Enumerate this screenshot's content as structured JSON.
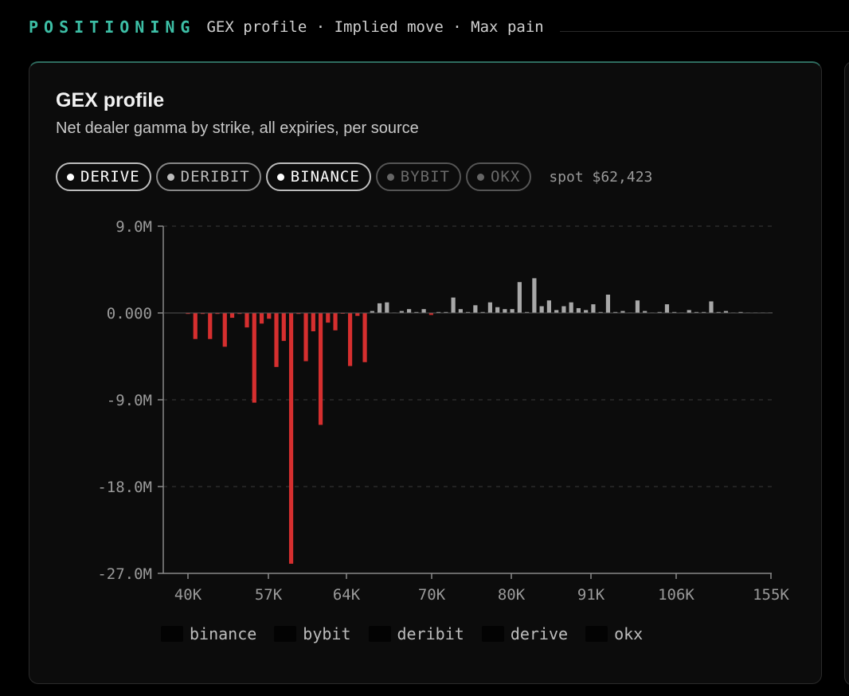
{
  "header": {
    "tag": "POSITIONING",
    "subtitle": "GEX profile · Implied move · Max pain"
  },
  "card": {
    "title": "GEX profile",
    "subtitle": "Net dealer gamma by strike, all expiries, per source"
  },
  "sources": [
    {
      "label": "DERIVE",
      "state": "on"
    },
    {
      "label": "DERIBIT",
      "state": "partial"
    },
    {
      "label": "BINANCE",
      "state": "on"
    },
    {
      "label": "BYBIT",
      "state": "off"
    },
    {
      "label": "OKX",
      "state": "off"
    }
  ],
  "spot": "spot $62,423",
  "colors": {
    "accent": "#3dbfa6",
    "negative": "#d62f2f",
    "positive": "#a8a8a8"
  },
  "chart_data": {
    "type": "bar",
    "title": "GEX profile",
    "y_tick_labels": [
      "9.0M",
      "0.000",
      "-9.0M",
      "-18.0M",
      "-27.0M"
    ],
    "y_ticks": [
      9,
      0,
      -9,
      -18,
      -27
    ],
    "ylim": [
      -27,
      9
    ],
    "x_tick_labels": [
      "40K",
      "57K",
      "64K",
      "70K",
      "80K",
      "91K",
      "106K",
      "155K"
    ],
    "grid": "horizontal dashed",
    "legend": [
      "binance",
      "bybit",
      "deribit",
      "derive",
      "okx"
    ],
    "legend_position": "bottom",
    "values": [
      -0.1,
      -2.7,
      -0.1,
      -2.7,
      -0.1,
      -3.5,
      -0.5,
      -0.1,
      -1.5,
      -9.3,
      -1.1,
      -0.6,
      -5.6,
      -2.9,
      -26.0,
      -0.1,
      -5.0,
      -1.9,
      -11.6,
      -1.0,
      -1.8,
      -0.05,
      -5.5,
      -0.3,
      -5.1,
      0.2,
      1.0,
      1.1,
      0.05,
      0.2,
      0.4,
      0.1,
      0.4,
      -0.2,
      0.1,
      0.1,
      1.6,
      0.4,
      0.1,
      0.8,
      0.1,
      1.1,
      0.6,
      0.4,
      0.4,
      3.2,
      0.1,
      3.6,
      0.7,
      1.3,
      0.3,
      0.7,
      1.1,
      0.5,
      0.3,
      0.9,
      0.1,
      1.9,
      0.1,
      0.2,
      0.05,
      1.3,
      0.2,
      0.05,
      0.1,
      0.9,
      0.1,
      0.05,
      0.3,
      0.1,
      0.1,
      1.2,
      0.1,
      0.2,
      0.05,
      0.1,
      0.05,
      0.05,
      0.05,
      0.05
    ]
  }
}
